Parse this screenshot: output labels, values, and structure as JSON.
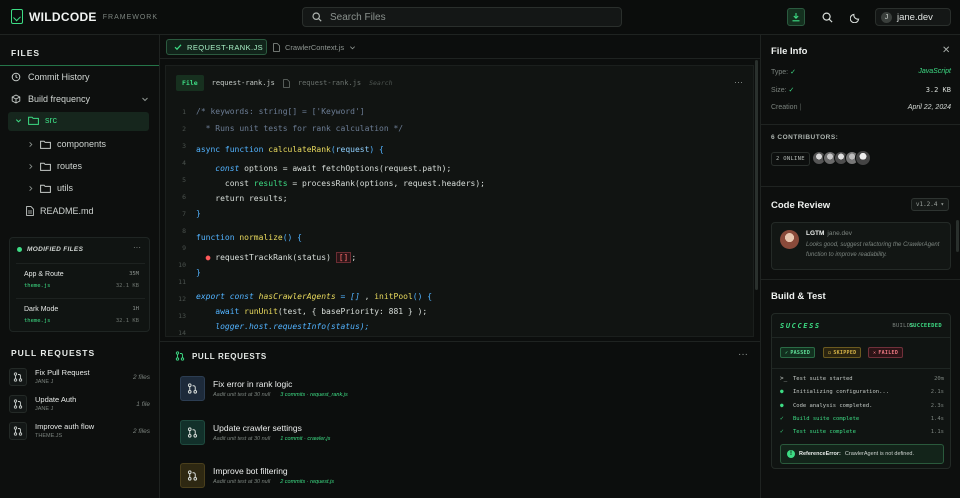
{
  "app": {
    "name": "WILDCODE",
    "subtitle": "FRAMEWORK"
  },
  "header": {
    "search_placeholder": "Search Files",
    "user": {
      "initial": "J",
      "name": "jane.dev"
    }
  },
  "sidebar": {
    "files_heading": "FILES",
    "nav": [
      {
        "label": "Commit History",
        "icon": "history-icon"
      },
      {
        "label": "Build frequency",
        "icon": "cube-icon"
      }
    ],
    "tree": [
      {
        "label": "src",
        "type": "folder",
        "expanded": true
      },
      {
        "label": "components",
        "type": "folder"
      },
      {
        "label": "routes",
        "type": "folder"
      },
      {
        "label": "utils",
        "type": "folder"
      },
      {
        "label": "README.md",
        "type": "file"
      }
    ],
    "modified": {
      "title": "MODIFIED FILES",
      "items": [
        {
          "name": "App & Route",
          "file": "theme.js",
          "time": "35M",
          "size": "32.1 KB"
        },
        {
          "name": "Dark Mode",
          "file": "theme.js",
          "time": "1H",
          "size": "32.1 KB"
        }
      ]
    },
    "pull_requests_heading": "PULL REQUESTS",
    "pull_requests": [
      {
        "title": "Fix Pull Request",
        "author": "JANE J",
        "count": "2 files"
      },
      {
        "title": "Update Auth",
        "author": "JANE J",
        "count": "1 file"
      },
      {
        "title": "Improve auth flow",
        "author": "THEME.JS",
        "count": "2 files"
      }
    ]
  },
  "tabs": [
    {
      "label": "REQUEST-RANK.JS",
      "active": true
    },
    {
      "label": "CrawlerContext.js",
      "active": false
    }
  ],
  "editor": {
    "badge": "File",
    "filename": "request-rank.js",
    "crumb": "request-rank.js",
    "search_label": "Search",
    "line_numbers": [
      "1",
      "2",
      "3",
      "4",
      "5",
      "6",
      "7",
      "8",
      "9",
      "10",
      "11",
      "12",
      "13",
      "14",
      "15"
    ]
  },
  "pr_panel": {
    "heading": "PULL REQUESTS",
    "items": [
      {
        "title": "Fix error in rank logic",
        "meta": "Aadit unit test at 30 null",
        "commits": "3 commits · request_rank.js",
        "color": "#1d2a3a"
      },
      {
        "title": "Update crawler settings",
        "meta": "Aadit unit test at 30 null",
        "commits": "1 commit · crawler.js",
        "color": "#12302a"
      },
      {
        "title": "Improve bot filtering",
        "meta": "Aadit unit test at 30 null",
        "commits": "2 commits · request.js",
        "color": "#2e2812"
      }
    ]
  },
  "file_info": {
    "heading": "File Info",
    "rows": [
      {
        "key": "Type:",
        "value": "JavaScript",
        "color": "#3ddc84"
      },
      {
        "key": "Size:",
        "value": "3.2 KB",
        "color": "#d8ddd9"
      },
      {
        "key": "Creation",
        "value": "April 22, 2024",
        "color": "#d8ddd9"
      }
    ],
    "contributors_label": "6 CONTRIBUTORS:",
    "online_label": "2 ONLINE"
  },
  "code_review": {
    "heading": "Code Review",
    "version": "v1.2.4",
    "status": "LGTM",
    "author": "jane.dev",
    "comment": "Looks good, suggest refactoring the CrawlerAgent function to improve readability."
  },
  "build": {
    "heading": "Build & Test",
    "status": "SUCCESS",
    "build_label": "BUILDS",
    "build_value": "SUCCEEDED",
    "chips": [
      "PASSED",
      "SKIPPED",
      "FAILED"
    ],
    "log": [
      {
        "text": "Test suite started",
        "time": "20m",
        "icon": "terminal-icon"
      },
      {
        "text": "Initializing configuration...",
        "time": "2.1s",
        "icon": "circle-check-icon"
      },
      {
        "text": "Code analysis completed.",
        "time": "2.3s",
        "icon": "circle-check-icon"
      },
      {
        "text": "Build suite complete",
        "time": "1.4s",
        "icon": "check-icon"
      },
      {
        "text": "Test suite complete",
        "time": "1.1s",
        "icon": "check-icon"
      }
    ],
    "error_label": "ReferenceError:",
    "error_text": "CrawlerAgent is not defined."
  },
  "colors": {
    "accent": "#3ddc84",
    "background": "#0c0e0d"
  }
}
